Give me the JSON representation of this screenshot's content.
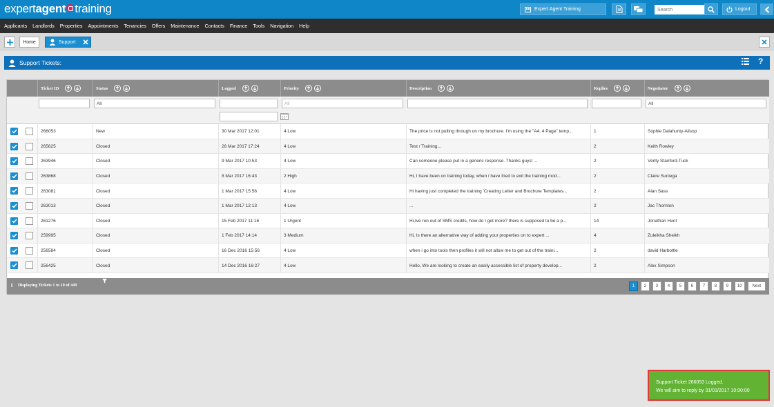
{
  "brand": {
    "logo_part1": "expert",
    "logo_part2": "agent",
    "logo_part3": "training"
  },
  "topbar": {
    "account_label": "Expert Agent Training",
    "search_placeholder": "Search",
    "logout_label": "Logout"
  },
  "nav": {
    "items": [
      "Applicants",
      "Landlords",
      "Properties",
      "Appointments",
      "Tenancies",
      "Offers",
      "Maintenance",
      "Contacts",
      "Finance",
      "Tools",
      "Navigation",
      "Help"
    ]
  },
  "tabs": {
    "home_label": "Home",
    "support_label": "Support"
  },
  "panel": {
    "title": "Support Tickets:",
    "help_label": "?"
  },
  "grid": {
    "columns": {
      "ticket_id": "Ticket ID",
      "status": "Status",
      "logged": "Logged",
      "priority": "Priority",
      "description": "Description",
      "replies": "Replies",
      "negotiator": "Negotiator"
    },
    "filters": {
      "status": "All",
      "priority": "All",
      "negotiator": "All"
    },
    "rows": [
      {
        "id": "266053",
        "status": "New",
        "logged": "30 Mar 2017 12:01",
        "priority": "4 Low",
        "description": "The price is not pulling through on my brochure. I'm using the \"A4, 4 Page\" temp...",
        "replies": "1",
        "negotiator": "Sophie Dalahunty-Allsop"
      },
      {
        "id": "265825",
        "status": "Closed",
        "logged": "28 Mar 2017 17:24",
        "priority": "4 Low",
        "description": "Test / Training...",
        "replies": "2",
        "negotiator": "Keith Rowley"
      },
      {
        "id": "263946",
        "status": "Closed",
        "logged": "9 Mar 2017 10:53",
        "priority": "4 Low",
        "description": "Can someone please put in a generic response.  Thanks guys! ...",
        "replies": "2",
        "negotiator": "Verity Stanford-Tuck"
      },
      {
        "id": "263868",
        "status": "Closed",
        "logged": "8 Mar 2017 16:43",
        "priority": "2 High",
        "description": "Hi, I have been on training today, when i have tried to exit the training mod...",
        "replies": "2",
        "negotiator": "Claire Suniega"
      },
      {
        "id": "263081",
        "status": "Closed",
        "logged": "1 Mar 2017 15:56",
        "priority": "4 Low",
        "description": "Hi having just completed the training 'Creating Letter and Brochure Templates...",
        "replies": "2",
        "negotiator": "Alan Sass"
      },
      {
        "id": "263013",
        "status": "Closed",
        "logged": "1 Mar 2017 12:13",
        "priority": "4 Low",
        "description": "...",
        "replies": "2",
        "negotiator": "Jac Thornton"
      },
      {
        "id": "261276",
        "status": "Closed",
        "logged": "15 Feb 2017 11:16",
        "priority": "1 Urgent",
        "description": "Hi,Ive run out of SMS credits, how do I get more? there is supposed to be a p...",
        "replies": "14",
        "negotiator": "Jonathan Hunt"
      },
      {
        "id": "259995",
        "status": "Closed",
        "logged": "1 Feb 2017 14:14",
        "priority": "3 Medium",
        "description": "Hi,  Is there an alternative way of adding your properties on to expert ...",
        "replies": "4",
        "negotiator": "Zuleikha Sheikh"
      },
      {
        "id": "256584",
        "status": "Closed",
        "logged": "16 Dec 2016 15:56",
        "priority": "4 Low",
        "description": "when i go into tools then profiles it will not allow me to get out of the traini...",
        "replies": "2",
        "negotiator": "david Harbottle"
      },
      {
        "id": "256425",
        "status": "Closed",
        "logged": "14 Dec 2016 16:27",
        "priority": "4 Low",
        "description": "Hello, We are looking to create an easily accessible list of property develop...",
        "replies": "2",
        "negotiator": "Alex Simpson"
      }
    ],
    "footer_text": "Displaying Tickets 1 to 10 of 449",
    "info_icon_label": "i",
    "pages": [
      "1",
      "2",
      "3",
      "4",
      "5",
      "6",
      "7",
      "8",
      "9",
      "10"
    ],
    "current_page": "1",
    "next_label": "Next"
  },
  "notification": {
    "line1": "Support Ticket 266053 Logged.",
    "line2": "We will aim to reply by 31/03/2017 10:00:00"
  },
  "colors": {
    "topbar": "#0e86c8",
    "navbar": "#2e2e2e",
    "panel_header": "#0e70b8",
    "notification_bg": "#62b234",
    "notification_border": "#e23838"
  }
}
